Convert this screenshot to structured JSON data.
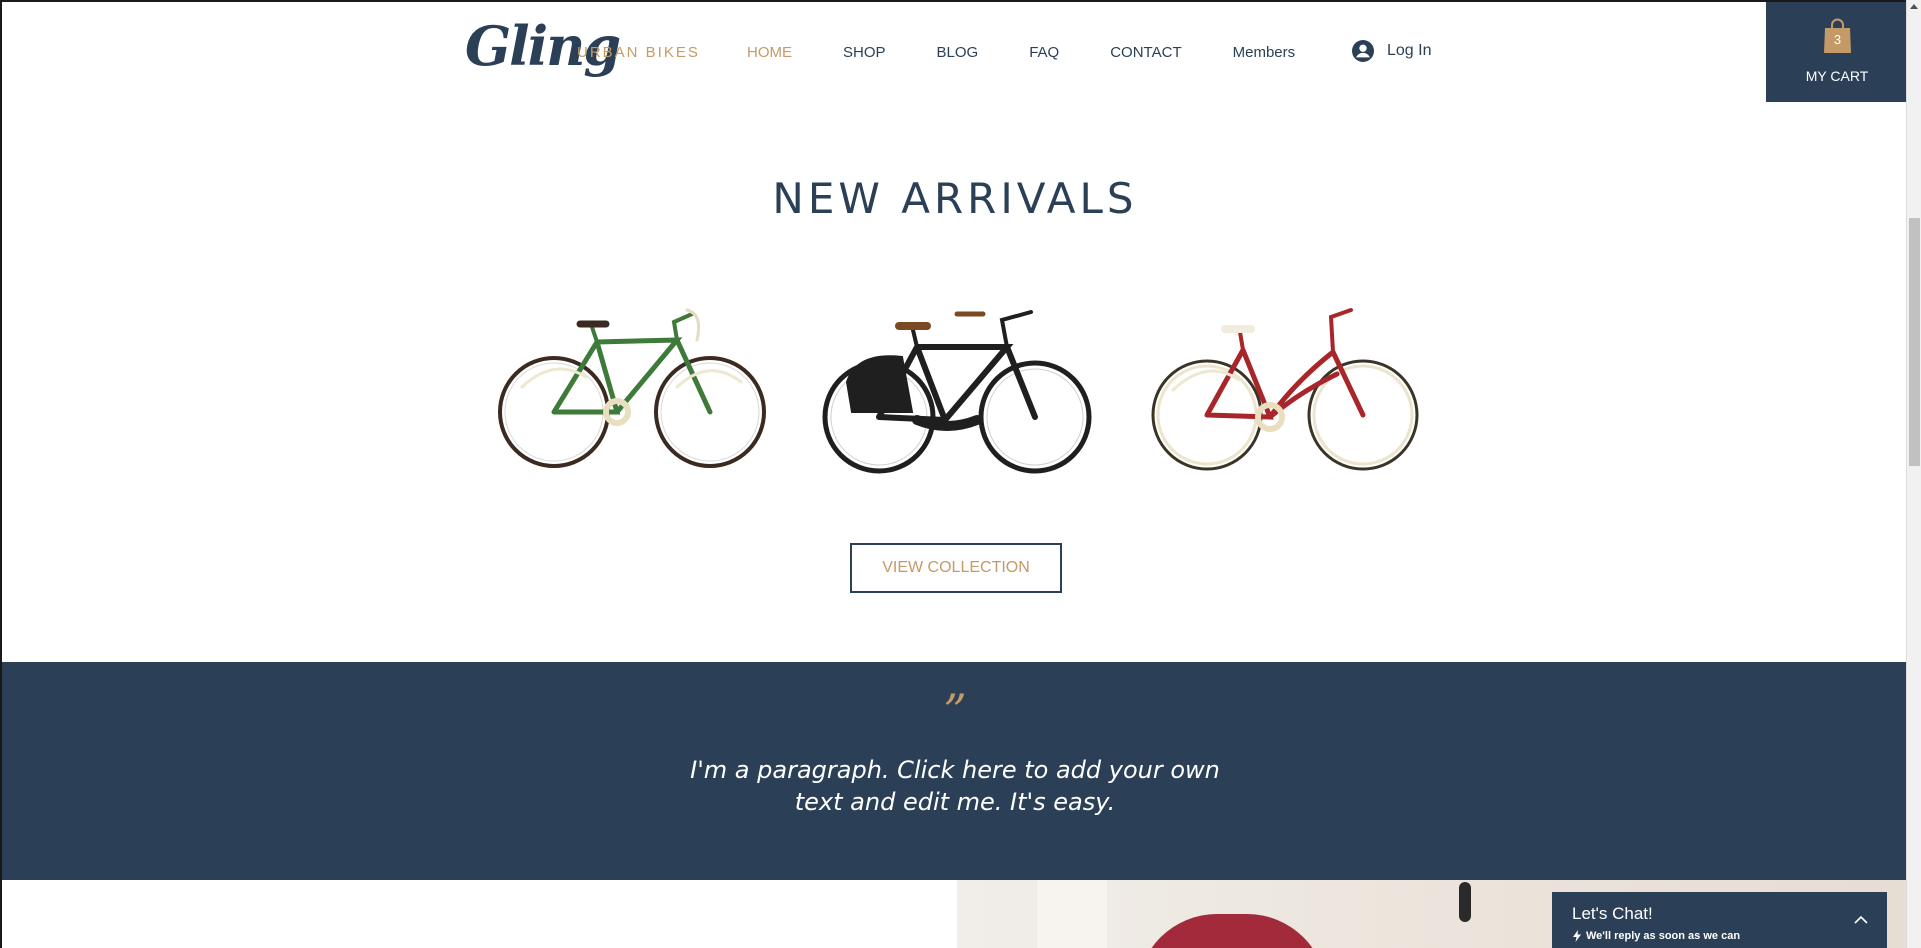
{
  "header": {
    "logo": "Gling",
    "tagline": "URBAN BIKES",
    "nav": [
      {
        "label": "HOME",
        "active": true
      },
      {
        "label": "SHOP",
        "active": false
      },
      {
        "label": "BLOG",
        "active": false
      },
      {
        "label": "FAQ",
        "active": false
      },
      {
        "label": "CONTACT",
        "active": false
      },
      {
        "label": "Members",
        "active": false
      }
    ],
    "login_label": "Log In",
    "cart": {
      "count": "3",
      "label": "MY CART"
    }
  },
  "arrivals": {
    "title": "NEW ARRIVALS",
    "bikes": [
      {
        "name": "green-bike",
        "frame_color": "#3e7a3a"
      },
      {
        "name": "black-bike",
        "frame_color": "#1f1f1f"
      },
      {
        "name": "red-bike",
        "frame_color": "#a8252a"
      }
    ],
    "button_label": "VIEW COLLECTION"
  },
  "quote": {
    "mark": "”",
    "text_line1": "I'm a paragraph. Click here to add your own",
    "text_line2": "text and edit me. It's easy."
  },
  "chat": {
    "title": "Let's Chat!",
    "subtitle": "We'll reply as soon as we can"
  },
  "colors": {
    "navy": "#2b4057",
    "gold": "#c49a66"
  }
}
